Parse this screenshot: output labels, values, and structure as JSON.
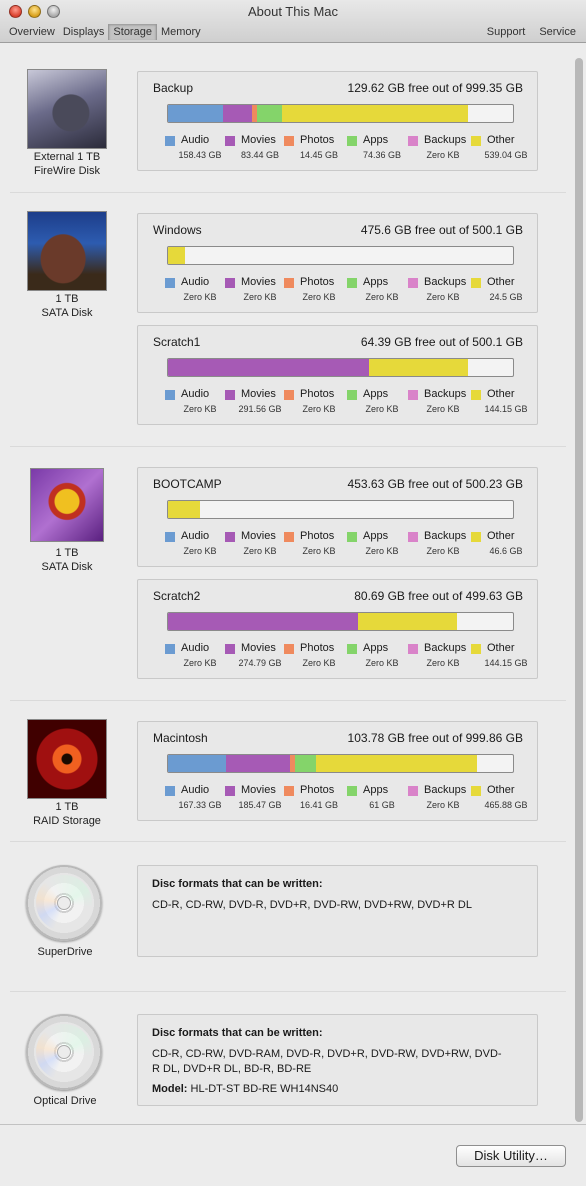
{
  "window": {
    "title": "About This Mac",
    "tabs": [
      "Overview",
      "Displays",
      "Storage",
      "Memory"
    ],
    "active_tab": "Storage",
    "right_links": [
      "Support",
      "Service"
    ]
  },
  "colors": {
    "audio": "#6b9bd1",
    "movies": "#a65ab5",
    "photos": "#ef8a5e",
    "apps": "#84d46a",
    "backups": "#d983c9",
    "other": "#e6d93a"
  },
  "legend_labels": [
    "Audio",
    "Movies",
    "Photos",
    "Apps",
    "Backups",
    "Other"
  ],
  "devices": [
    {
      "label_line1": "External 1 TB",
      "label_line2": "FireWire Disk",
      "volumes": [
        {
          "name": "Backup",
          "free_text": "129.62 GB free out of 999.35 GB",
          "values": [
            "158.43 GB",
            "83.44 GB",
            "14.45 GB",
            "74.36 GB",
            "Zero KB",
            "539.04 GB"
          ],
          "fractions": [
            0.159,
            0.084,
            0.014,
            0.074,
            0.0,
            0.539
          ]
        }
      ]
    },
    {
      "label_line1": "1 TB",
      "label_line2": "SATA Disk",
      "volumes": [
        {
          "name": "Windows",
          "free_text": "475.6 GB free out of 500.1 GB",
          "values": [
            "Zero KB",
            "Zero KB",
            "Zero KB",
            "Zero KB",
            "Zero KB",
            "24.5 GB"
          ],
          "fractions": [
            0,
            0,
            0,
            0,
            0,
            0.049
          ]
        },
        {
          "name": "Scratch1",
          "free_text": "64.39 GB free out of 500.1 GB",
          "values": [
            "Zero KB",
            "291.56 GB",
            "Zero KB",
            "Zero KB",
            "Zero KB",
            "144.15 GB"
          ],
          "fractions": [
            0,
            0.583,
            0,
            0,
            0,
            0.288
          ]
        }
      ]
    },
    {
      "label_line1": "1 TB",
      "label_line2": "SATA Disk",
      "volumes": [
        {
          "name": "BOOTCAMP",
          "free_text": "453.63 GB free out of 500.23 GB",
          "values": [
            "Zero KB",
            "Zero KB",
            "Zero KB",
            "Zero KB",
            "Zero KB",
            "46.6 GB"
          ],
          "fractions": [
            0,
            0,
            0,
            0,
            0,
            0.093
          ]
        },
        {
          "name": "Scratch2",
          "free_text": "80.69 GB free out of 499.63 GB",
          "values": [
            "Zero KB",
            "274.79 GB",
            "Zero KB",
            "Zero KB",
            "Zero KB",
            "144.15 GB"
          ],
          "fractions": [
            0,
            0.55,
            0,
            0,
            0,
            0.289
          ]
        }
      ]
    },
    {
      "label_line1": "1 TB",
      "label_line2": "RAID Storage",
      "volumes": [
        {
          "name": "Macintosh",
          "free_text": "103.78 GB free out of 999.86 GB",
          "values": [
            "167.33 GB",
            "185.47 GB",
            "16.41 GB",
            "61 GB",
            "Zero KB",
            "465.88 GB"
          ],
          "fractions": [
            0.167,
            0.186,
            0.016,
            0.061,
            0,
            0.466
          ]
        }
      ]
    }
  ],
  "optical": [
    {
      "label": "SuperDrive",
      "heading": "Disc formats that can be written:",
      "formats": "CD-R, CD-RW, DVD-R, DVD+R, DVD-RW, DVD+RW, DVD+R DL",
      "model_label": "",
      "model": ""
    },
    {
      "label": "Optical Drive",
      "heading": "Disc formats that can be written:",
      "formats": "CD-R, CD-RW, DVD-RAM, DVD-R, DVD+R, DVD-RW, DVD+RW, DVD-R DL, DVD+R DL, BD-R, BD-RE",
      "model_label": "Model:",
      "model": "HL-DT-ST BD-RE WH14NS40"
    }
  ],
  "footer": {
    "disk_utility_label": "Disk Utility…"
  }
}
